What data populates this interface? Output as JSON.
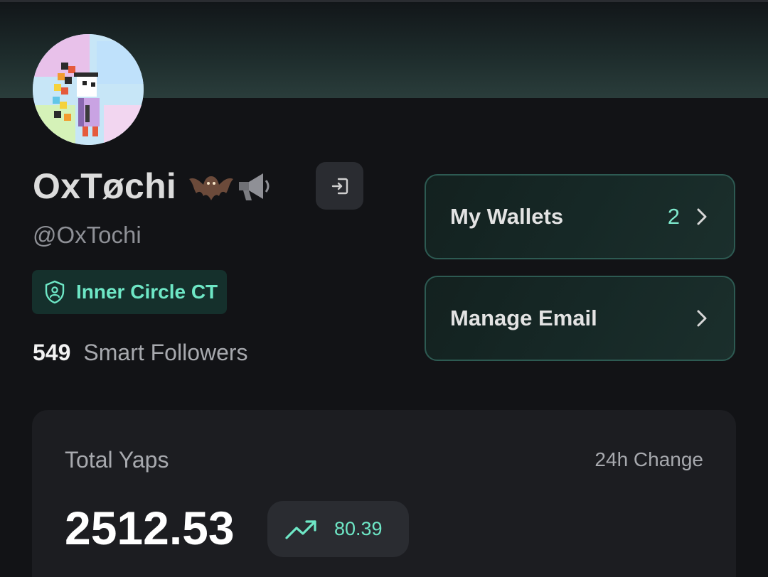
{
  "profile": {
    "display_name": "OxTøchi",
    "emoji_icons": [
      "bat-icon",
      "megaphone-icon"
    ],
    "handle": "@OxTochi",
    "badge_label": "Inner Circle CT",
    "smart_followers_count": "549",
    "smart_followers_label": "Smart Followers"
  },
  "actions": {
    "wallets_label": "My Wallets",
    "wallets_count": "2",
    "email_label": "Manage Email"
  },
  "stats": {
    "title": "Total Yaps",
    "change_label": "24h Change",
    "total_value": "2512.53",
    "change_value": "80.39"
  },
  "colors": {
    "background": "#121316",
    "accent": "#6ee7c6",
    "card_border": "#2d5a52",
    "badge_bg": "#15302c"
  }
}
